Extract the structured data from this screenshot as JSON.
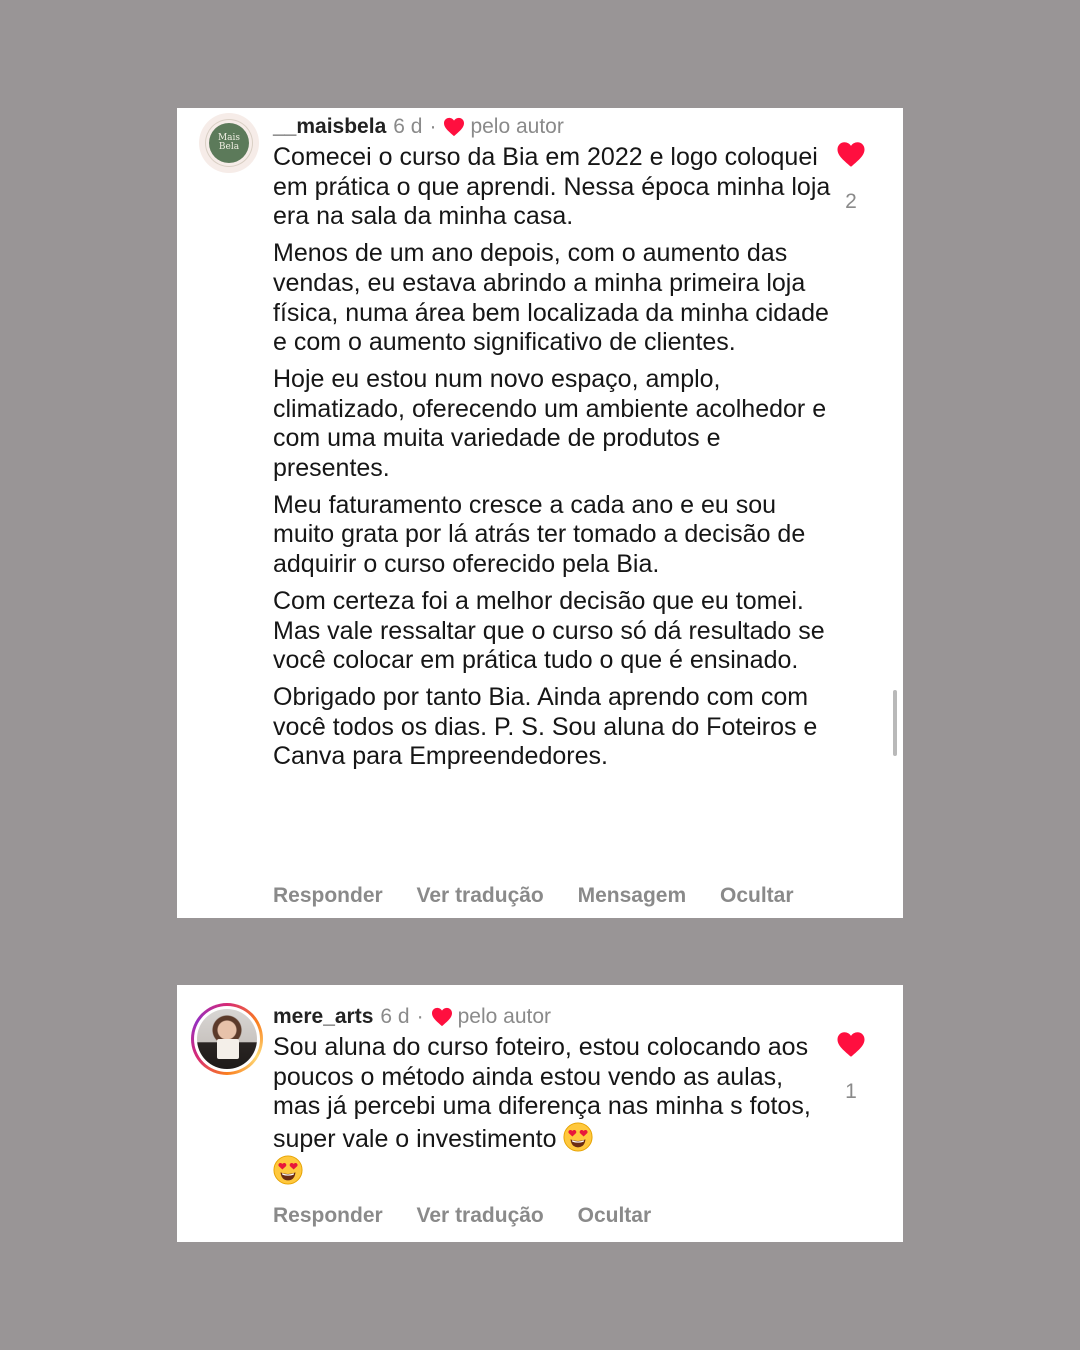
{
  "comments": [
    {
      "username": "__maisbela",
      "time": "6 d",
      "separator": "·",
      "liked_by_author": "pelo autor",
      "avatar_logo_text": [
        "Mais",
        "Bela"
      ],
      "paragraphs": [
        "Comecei o curso da Bia em 2022 e logo coloquei em prática o que aprendi. Nessa época minha loja era na sala da minha casa.",
        "Menos de um ano depois, com o aumento das vendas, eu estava abrindo a minha primeira loja física, numa área bem localizada da minha cidade e com o aumento significativo de clientes.",
        "Hoje eu estou num novo espaço,  amplo, climatizado, oferecendo um ambiente acolhedor e com uma muita variedade de produtos e presentes.",
        "Meu faturamento cresce a cada ano e eu sou muito grata por lá atrás ter tomado a decisão de adquirir o curso oferecido pela Bia.",
        "Com certeza foi a melhor decisão que eu tomei. Mas vale ressaltar que o curso só dá resultado se você colocar em prática tudo o que é ensinado.",
        "Obrigado por tanto Bia. Ainda aprendo com com você todos os dias. P. S. Sou aluna do Foteiros e Canva para Empreendedores."
      ],
      "actions": [
        "Responder",
        "Ver tradução",
        "Mensagem",
        "Ocultar"
      ],
      "like_count": "2"
    },
    {
      "username": "mere_arts",
      "time": "6 d",
      "separator": "·",
      "liked_by_author": "pelo autor",
      "text_main": "Sou aluna do curso foteiro, estou colocando aos poucos o método ainda estou vendo as aulas, mas já percebi uma diferença nas minha s fotos, super vale o investimento ",
      "emoji": "heart-eyes",
      "actions": [
        "Responder",
        "Ver tradução",
        "Ocultar"
      ],
      "like_count": "1"
    }
  ],
  "colors": {
    "background": "#999596",
    "heart": "#ff0f3f",
    "secondary_text": "#8a8a8a"
  }
}
